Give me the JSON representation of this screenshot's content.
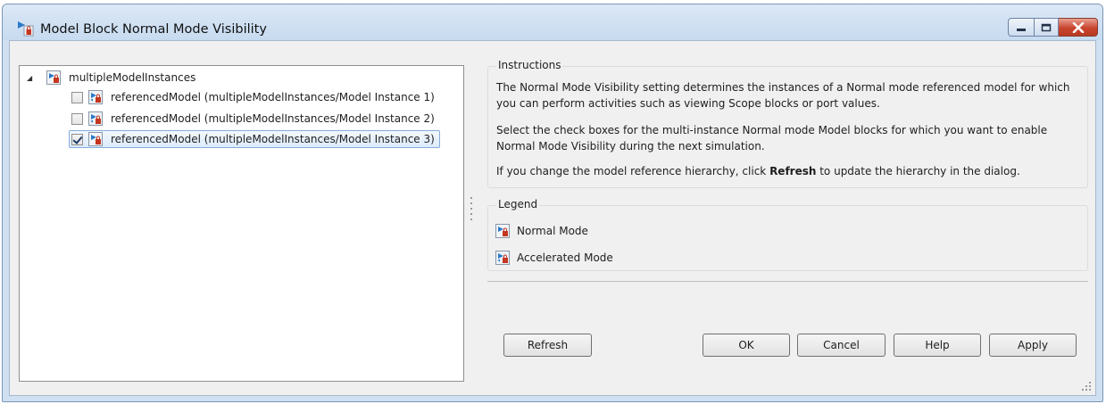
{
  "window": {
    "title": "Model Block Normal Mode Visibility"
  },
  "tree": {
    "root": {
      "label": "multipleModelInstances",
      "expanded": true,
      "icon": "normal-mode-model-icon"
    },
    "children": [
      {
        "label": "referencedModel (multipleModelInstances/Model Instance 1)",
        "checked": false,
        "icon": "accelerated-mode-model-icon"
      },
      {
        "label": "referencedModel (multipleModelInstances/Model Instance 2)",
        "checked": false,
        "icon": "accelerated-mode-model-icon"
      },
      {
        "label": "referencedModel (multipleModelInstances/Model Instance 3)",
        "checked": true,
        "icon": "normal-mode-model-icon",
        "selected": true
      }
    ]
  },
  "instructions": {
    "heading": "Instructions",
    "p1": "The Normal Mode Visibility setting determines the instances of a Normal mode referenced model for which you can perform activities such as viewing Scope blocks or port values.",
    "p2": "Select the check boxes for the multi-instance Normal mode Model blocks for which you want to enable Normal Mode Visibility during the next simulation.",
    "p3_before": "If you change the model reference hierarchy, click ",
    "p3_bold": "Refresh",
    "p3_after": " to update the hierarchy in the dialog."
  },
  "legend": {
    "heading": "Legend",
    "items": [
      {
        "label": "Normal Mode",
        "icon": "normal-mode-model-icon"
      },
      {
        "label": "Accelerated Mode",
        "icon": "accelerated-mode-model-icon"
      }
    ]
  },
  "buttons": {
    "refresh": "Refresh",
    "ok": "OK",
    "cancel": "Cancel",
    "help": "Help",
    "apply": "Apply"
  },
  "colors": {
    "titlebar": "#c7dbf0",
    "selection": "#dcebfc",
    "close_button": "#c9452d"
  }
}
